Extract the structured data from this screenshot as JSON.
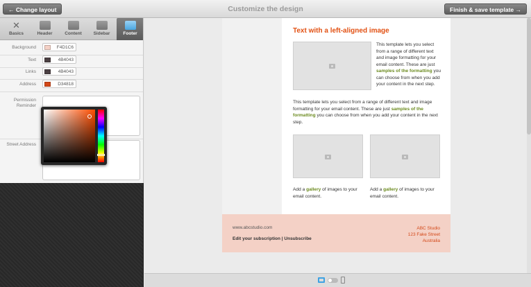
{
  "topbar": {
    "back_label": "← Change layout",
    "title": "Customize the design",
    "finish_label": "Finish & save template →"
  },
  "tabs": [
    {
      "label": "Basics",
      "icon": "tools-icon"
    },
    {
      "label": "Header",
      "icon": "header-icon"
    },
    {
      "label": "Content",
      "icon": "content-icon"
    },
    {
      "label": "Sidebar",
      "icon": "sidebar-icon"
    },
    {
      "label": "Footer",
      "icon": "footer-icon",
      "active": true
    }
  ],
  "fields": {
    "background": {
      "label": "Background",
      "value": "F4D1C6",
      "color": "#F4D1C6"
    },
    "text": {
      "label": "Text",
      "value": "4B4043",
      "color": "#4B4043"
    },
    "links": {
      "label": "Links",
      "value": "4B4043",
      "color": "#4B4043"
    },
    "address": {
      "label": "Address",
      "value": "D34818",
      "color": "#D34818"
    },
    "permission_label_1": "Permission",
    "permission_label_2": "Reminder",
    "street_label": "Street Address",
    "street_lines": [
      "123 Fake Street",
      "Australia"
    ]
  },
  "email": {
    "title": "Text with a left-aligned image",
    "para1_a": "This template lets you select from a range of different text and image formatting for your email content. These are just ",
    "para1_hl": "samples of the formatting",
    "para1_b": " you can choose from when you add your content in the next step.",
    "para2_a": "This template lets you select from a range of different text and image formatting for your email content. These are just ",
    "para2_hl": "samples of the formatting",
    "para2_b": " you can choose from when you add your content in the next step.",
    "gallery_a": "Add a ",
    "gallery_hl": "gallery",
    "gallery_b": " of images to your email content."
  },
  "footer": {
    "url": "www.abcstudio.com",
    "links": "Edit your subscription | Unsubscribe",
    "addr_lines": [
      "ABC Studio",
      "123 Fake Street",
      "Australia"
    ]
  }
}
